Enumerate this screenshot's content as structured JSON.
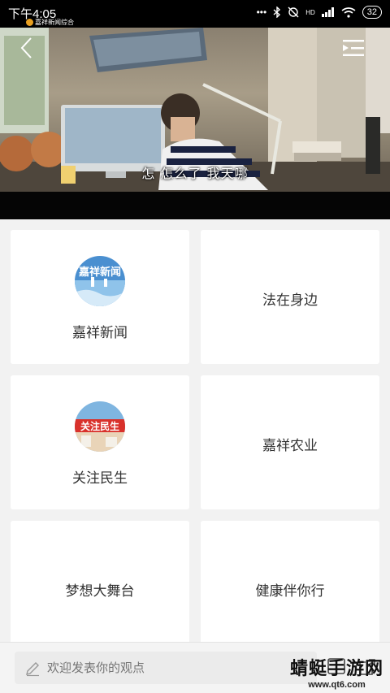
{
  "status_bar": {
    "time": "下午4:05",
    "dots": "•••",
    "network": "HD",
    "battery": "32",
    "notification_label": "嘉祥新闻综合"
  },
  "video": {
    "subtitle": "怎 怎么了 我天哪"
  },
  "cards": [
    {
      "label": "嘉祥新闻",
      "logo_text": "嘉祥新闻",
      "has_logo": true
    },
    {
      "label": "法在身边",
      "has_logo": false
    },
    {
      "label": "关注民生",
      "logo_text": "关注民生",
      "has_logo": true
    },
    {
      "label": "嘉祥农业",
      "has_logo": false
    },
    {
      "label": "梦想大舞台",
      "has_logo": false
    },
    {
      "label": "健康伴你行",
      "has_logo": false
    }
  ],
  "comment": {
    "placeholder": "欢迎发表你的观点"
  },
  "watermark": {
    "title": "蜻蜓手游网",
    "url": "www.qt6.com"
  }
}
